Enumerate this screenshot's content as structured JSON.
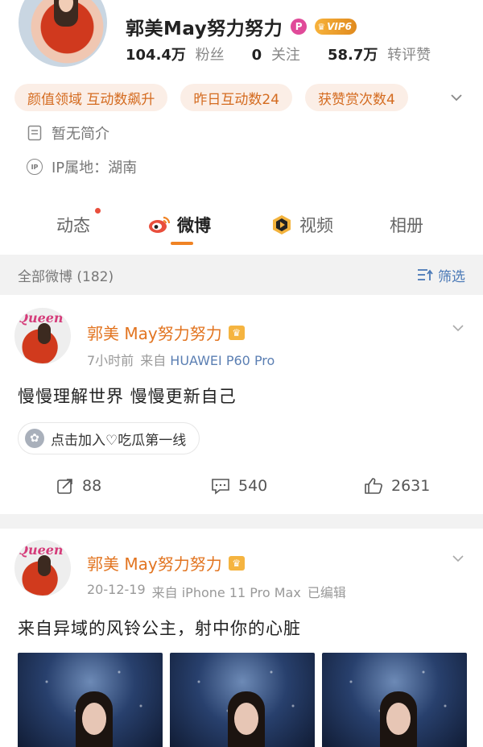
{
  "profile": {
    "name": "郭美May努力努力",
    "vip_label": "VIP6",
    "stats": [
      {
        "value": "104.4万",
        "label": "粉丝"
      },
      {
        "value": "0",
        "label": "关注"
      },
      {
        "value": "58.7万",
        "label": "转评赞"
      }
    ],
    "tags": [
      "颜值领域 互动数飙升",
      "昨日互动数24",
      "获赞赏次数4"
    ],
    "bio": "暂无简介",
    "ip_icon_text": "IP",
    "ip_location": "IP属地：湖南"
  },
  "tabs": [
    {
      "label": "动态",
      "active": false
    },
    {
      "label": "微博",
      "active": true
    },
    {
      "label": "视频",
      "active": false
    },
    {
      "label": "相册",
      "active": false
    }
  ],
  "filter": {
    "title": "全部微博 (182)",
    "button": "筛选"
  },
  "posts": [
    {
      "avatar_text": "Queen",
      "author": "郭美 May努力努力",
      "time": "7小时前",
      "source_prefix": "来自",
      "device": "HUAWEI P60 Pro",
      "text": "慢慢理解世界 慢慢更新自己",
      "topic": "点击加入♡吃瓜第一线",
      "reposts": "88",
      "comments": "540",
      "likes": "2631"
    },
    {
      "avatar_text": "Queen",
      "author": "郭美 May努力努力",
      "time": "20-12-19",
      "source_prefix": "来自",
      "device": "iPhone 11 Pro Max",
      "edited": "已编辑",
      "text": "来自异域的风铃公主，射中你的心脏",
      "photo_count": 3
    }
  ],
  "colors": {
    "accent_orange": "#f08324",
    "author_orange": "#e27420",
    "tag_bg": "#fbeee6",
    "tag_text": "#d46b1f",
    "link_blue": "#4a79b7",
    "separator_gray": "#f2f2f2"
  },
  "icons": [
    "doc-icon",
    "ip-icon",
    "chevron-down-icon",
    "weibo-eye-icon",
    "video-icon",
    "filter-icon",
    "crown-icon",
    "repost-icon",
    "comment-icon",
    "like-icon",
    "topic-icon"
  ]
}
